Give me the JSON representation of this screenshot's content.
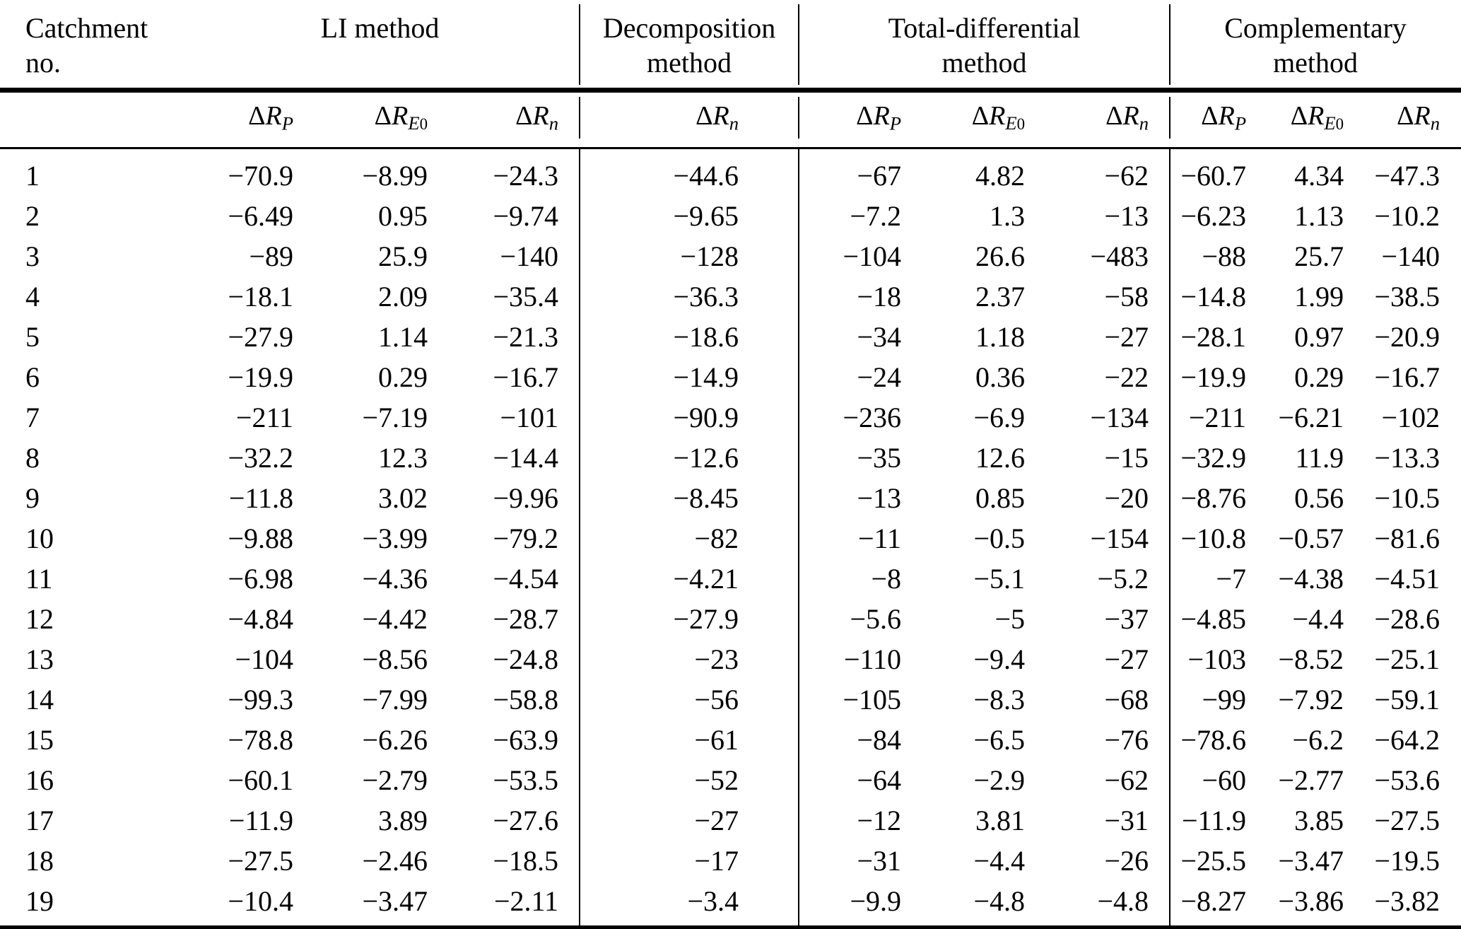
{
  "table": {
    "row_header_label": "Catchment\nno.",
    "row_header_line1": "Catchment",
    "row_header_line2": "no.",
    "groups": [
      {
        "id": "li",
        "line1": "LI method",
        "line2": "",
        "columns": [
          "dRP",
          "dRE0",
          "dRn"
        ]
      },
      {
        "id": "decomposition",
        "line1": "Decomposition",
        "line2": "method",
        "columns": [
          "dRn"
        ]
      },
      {
        "id": "total-differential",
        "line1": "Total-differential",
        "line2": "method",
        "columns": [
          "dRP",
          "dRE0",
          "dRn"
        ]
      },
      {
        "id": "complementary",
        "line1": "Complementary",
        "line2": "method",
        "columns": [
          "dRP",
          "dRE0",
          "dRn"
        ]
      }
    ],
    "symbols": {
      "delta": "Δ",
      "R": "R",
      "sub_P": "P",
      "sub_E0_E": "E",
      "sub_E0_0": "0",
      "sub_n": "n"
    },
    "column_headers": [
      "ΔR_P",
      "ΔR_E0",
      "ΔR_n",
      "ΔR_n",
      "ΔR_P",
      "ΔR_E0",
      "ΔR_n",
      "ΔR_P",
      "ΔR_E0",
      "ΔR_n"
    ],
    "rows": [
      {
        "no": "1",
        "li_RP": "−70.9",
        "li_RE0": "−8.99",
        "li_Rn": "−24.3",
        "dec_Rn": "−44.6",
        "td_RP": "−67",
        "td_RE0": "4.82",
        "td_Rn": "−62",
        "cm_RP": "−60.7",
        "cm_RE0": "4.34",
        "cm_Rn": "−47.3"
      },
      {
        "no": "2",
        "li_RP": "−6.49",
        "li_RE0": "0.95",
        "li_Rn": "−9.74",
        "dec_Rn": "−9.65",
        "td_RP": "−7.2",
        "td_RE0": "1.3",
        "td_Rn": "−13",
        "cm_RP": "−6.23",
        "cm_RE0": "1.13",
        "cm_Rn": "−10.2"
      },
      {
        "no": "3",
        "li_RP": "−89",
        "li_RE0": "25.9",
        "li_Rn": "−140",
        "dec_Rn": "−128",
        "td_RP": "−104",
        "td_RE0": "26.6",
        "td_Rn": "−483",
        "cm_RP": "−88",
        "cm_RE0": "25.7",
        "cm_Rn": "−140"
      },
      {
        "no": "4",
        "li_RP": "−18.1",
        "li_RE0": "2.09",
        "li_Rn": "−35.4",
        "dec_Rn": "−36.3",
        "td_RP": "−18",
        "td_RE0": "2.37",
        "td_Rn": "−58",
        "cm_RP": "−14.8",
        "cm_RE0": "1.99",
        "cm_Rn": "−38.5"
      },
      {
        "no": "5",
        "li_RP": "−27.9",
        "li_RE0": "1.14",
        "li_Rn": "−21.3",
        "dec_Rn": "−18.6",
        "td_RP": "−34",
        "td_RE0": "1.18",
        "td_Rn": "−27",
        "cm_RP": "−28.1",
        "cm_RE0": "0.97",
        "cm_Rn": "−20.9"
      },
      {
        "no": "6",
        "li_RP": "−19.9",
        "li_RE0": "0.29",
        "li_Rn": "−16.7",
        "dec_Rn": "−14.9",
        "td_RP": "−24",
        "td_RE0": "0.36",
        "td_Rn": "−22",
        "cm_RP": "−19.9",
        "cm_RE0": "0.29",
        "cm_Rn": "−16.7"
      },
      {
        "no": "7",
        "li_RP": "−211",
        "li_RE0": "−7.19",
        "li_Rn": "−101",
        "dec_Rn": "−90.9",
        "td_RP": "−236",
        "td_RE0": "−6.9",
        "td_Rn": "−134",
        "cm_RP": "−211",
        "cm_RE0": "−6.21",
        "cm_Rn": "−102"
      },
      {
        "no": "8",
        "li_RP": "−32.2",
        "li_RE0": "12.3",
        "li_Rn": "−14.4",
        "dec_Rn": "−12.6",
        "td_RP": "−35",
        "td_RE0": "12.6",
        "td_Rn": "−15",
        "cm_RP": "−32.9",
        "cm_RE0": "11.9",
        "cm_Rn": "−13.3"
      },
      {
        "no": "9",
        "li_RP": "−11.8",
        "li_RE0": "3.02",
        "li_Rn": "−9.96",
        "dec_Rn": "−8.45",
        "td_RP": "−13",
        "td_RE0": "0.85",
        "td_Rn": "−20",
        "cm_RP": "−8.76",
        "cm_RE0": "0.56",
        "cm_Rn": "−10.5"
      },
      {
        "no": "10",
        "li_RP": "−9.88",
        "li_RE0": "−3.99",
        "li_Rn": "−79.2",
        "dec_Rn": "−82",
        "td_RP": "−11",
        "td_RE0": "−0.5",
        "td_Rn": "−154",
        "cm_RP": "−10.8",
        "cm_RE0": "−0.57",
        "cm_Rn": "−81.6"
      },
      {
        "no": "11",
        "li_RP": "−6.98",
        "li_RE0": "−4.36",
        "li_Rn": "−4.54",
        "dec_Rn": "−4.21",
        "td_RP": "−8",
        "td_RE0": "−5.1",
        "td_Rn": "−5.2",
        "cm_RP": "−7",
        "cm_RE0": "−4.38",
        "cm_Rn": "−4.51"
      },
      {
        "no": "12",
        "li_RP": "−4.84",
        "li_RE0": "−4.42",
        "li_Rn": "−28.7",
        "dec_Rn": "−27.9",
        "td_RP": "−5.6",
        "td_RE0": "−5",
        "td_Rn": "−37",
        "cm_RP": "−4.85",
        "cm_RE0": "−4.4",
        "cm_Rn": "−28.6"
      },
      {
        "no": "13",
        "li_RP": "−104",
        "li_RE0": "−8.56",
        "li_Rn": "−24.8",
        "dec_Rn": "−23",
        "td_RP": "−110",
        "td_RE0": "−9.4",
        "td_Rn": "−27",
        "cm_RP": "−103",
        "cm_RE0": "−8.52",
        "cm_Rn": "−25.1"
      },
      {
        "no": "14",
        "li_RP": "−99.3",
        "li_RE0": "−7.99",
        "li_Rn": "−58.8",
        "dec_Rn": "−56",
        "td_RP": "−105",
        "td_RE0": "−8.3",
        "td_Rn": "−68",
        "cm_RP": "−99",
        "cm_RE0": "−7.92",
        "cm_Rn": "−59.1"
      },
      {
        "no": "15",
        "li_RP": "−78.8",
        "li_RE0": "−6.26",
        "li_Rn": "−63.9",
        "dec_Rn": "−61",
        "td_RP": "−84",
        "td_RE0": "−6.5",
        "td_Rn": "−76",
        "cm_RP": "−78.6",
        "cm_RE0": "−6.2",
        "cm_Rn": "−64.2"
      },
      {
        "no": "16",
        "li_RP": "−60.1",
        "li_RE0": "−2.79",
        "li_Rn": "−53.5",
        "dec_Rn": "−52",
        "td_RP": "−64",
        "td_RE0": "−2.9",
        "td_Rn": "−62",
        "cm_RP": "−60",
        "cm_RE0": "−2.77",
        "cm_Rn": "−53.6"
      },
      {
        "no": "17",
        "li_RP": "−11.9",
        "li_RE0": "3.89",
        "li_Rn": "−27.6",
        "dec_Rn": "−27",
        "td_RP": "−12",
        "td_RE0": "3.81",
        "td_Rn": "−31",
        "cm_RP": "−11.9",
        "cm_RE0": "3.85",
        "cm_Rn": "−27.5"
      },
      {
        "no": "18",
        "li_RP": "−27.5",
        "li_RE0": "−2.46",
        "li_Rn": "−18.5",
        "dec_Rn": "−17",
        "td_RP": "−31",
        "td_RE0": "−4.4",
        "td_Rn": "−26",
        "cm_RP": "−25.5",
        "cm_RE0": "−3.47",
        "cm_Rn": "−19.5"
      },
      {
        "no": "19",
        "li_RP": "−10.4",
        "li_RE0": "−3.47",
        "li_Rn": "−2.11",
        "dec_Rn": "−3.4",
        "td_RP": "−9.9",
        "td_RE0": "−4.8",
        "td_Rn": "−4.8",
        "cm_RP": "−8.27",
        "cm_RE0": "−3.86",
        "cm_Rn": "−3.82"
      }
    ]
  },
  "colors": {
    "rule": "#000000",
    "text": "#000000",
    "background": "#ffffff"
  }
}
